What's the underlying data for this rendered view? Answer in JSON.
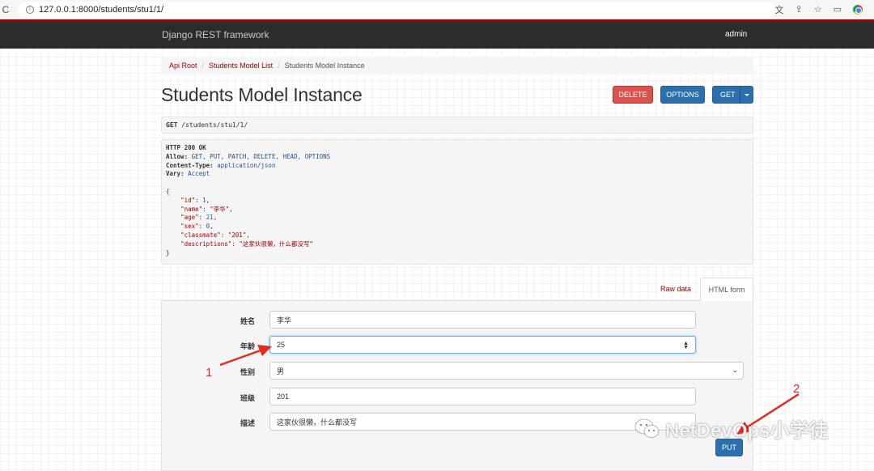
{
  "browser": {
    "url": "127.0.0.1:8000/students/stu1/1/"
  },
  "navbar": {
    "brand": "Django REST framework",
    "user": "admin"
  },
  "breadcrumb": {
    "items": [
      "Api Root",
      "Students Model List",
      "Students Model Instance"
    ]
  },
  "page": {
    "title": "Students Model Instance"
  },
  "actions": {
    "delete_label": "DELETE",
    "options_label": "OPTIONS",
    "get_label": "GET"
  },
  "request": {
    "method": "GET",
    "path": "/students/stu1/1/"
  },
  "response": {
    "status_line": "HTTP 200 OK",
    "headers": [
      {
        "key": "Allow:",
        "value": "GET, PUT, PATCH, DELETE, HEAD, OPTIONS"
      },
      {
        "key": "Content-Type:",
        "value": "application/json"
      },
      {
        "key": "Vary:",
        "value": "Accept"
      }
    ],
    "body": {
      "open": "{",
      "close": "}",
      "fields": [
        {
          "key": "\"id\"",
          "value": "1",
          "type": "number"
        },
        {
          "key": "\"name\"",
          "value": "\"李华\"",
          "type": "string"
        },
        {
          "key": "\"age\"",
          "value": "21",
          "type": "number"
        },
        {
          "key": "\"sex\"",
          "value": "0",
          "type": "number"
        },
        {
          "key": "\"classmate\"",
          "value": "\"201\"",
          "type": "string"
        },
        {
          "key": "\"descriptions\"",
          "value": "\"这家伙很懒，什么都没写\"",
          "type": "string"
        }
      ]
    }
  },
  "tabs": {
    "raw_data": "Raw data",
    "html_form": "HTML form"
  },
  "form": {
    "name_label": "姓名",
    "name_value": "李华",
    "age_label": "年龄",
    "age_value": "25",
    "sex_label": "性别",
    "sex_value": "男",
    "class_label": "班级",
    "class_value": "201",
    "desc_label": "描述",
    "desc_value": "这家伙很懒，什么都没写",
    "put_label": "PUT"
  },
  "annotations": {
    "marker_1": "1",
    "marker_2": "2",
    "color": "#e8291d"
  },
  "watermark": {
    "text": "NetDevOps小学徒"
  },
  "colors": {
    "accent_red": "#a30000",
    "primary_blue": "#2c6fad",
    "danger": "#d9534f",
    "navbar": "#2c2c2c"
  }
}
